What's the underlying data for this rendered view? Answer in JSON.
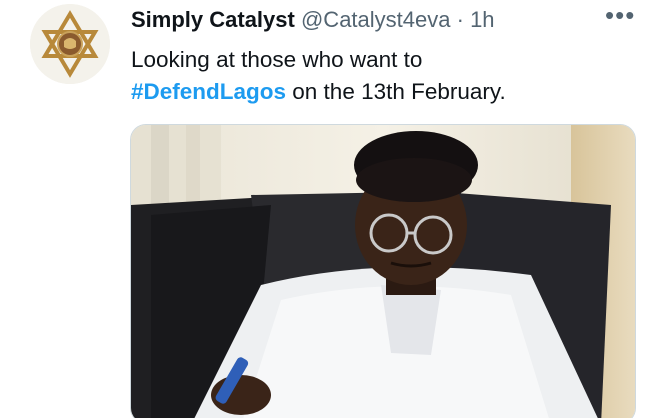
{
  "tweet": {
    "display_name": "Simply Catalyst",
    "handle": "@Catalyst4eva",
    "separator": "·",
    "time": "1h",
    "more_label": "•••",
    "text_line1": "Looking at those who want to",
    "hashtag": "#DefendLagos",
    "text_after_hashtag": " on the 13th February."
  },
  "colors": {
    "accent": "#1d9bf0",
    "text": "#0f1419",
    "muted": "#536471"
  },
  "icons": {
    "avatar": "star-of-david-emblem",
    "more": "more-horizontal-icon"
  }
}
